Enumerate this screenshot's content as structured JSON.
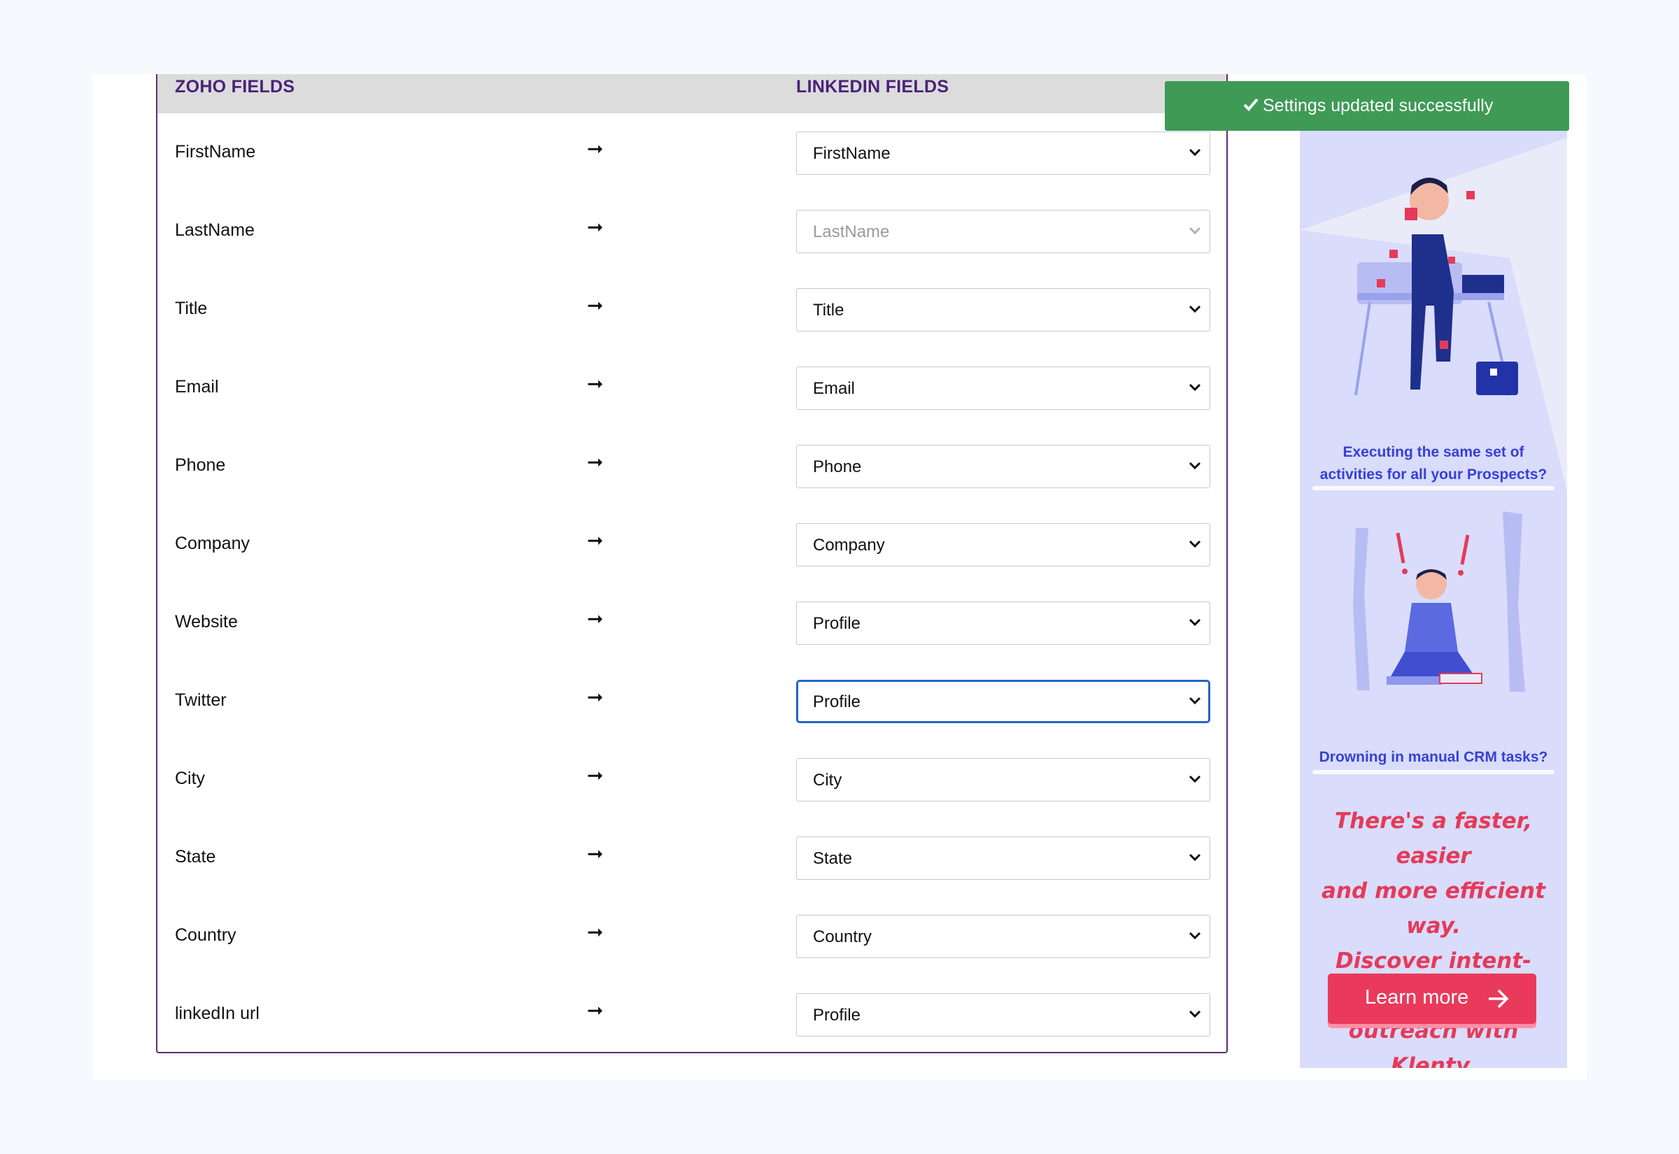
{
  "mapping": {
    "zoho_header": "ZOHO FIELDS",
    "linkedin_header": "LINKEDIN FIELDS",
    "arrow_glyph": "➞",
    "rows": [
      {
        "zoho": "FirstName",
        "linkedin": "FirstName"
      },
      {
        "zoho": "LastName",
        "linkedin": "LastName"
      },
      {
        "zoho": "Title",
        "linkedin": "Title"
      },
      {
        "zoho": "Email",
        "linkedin": "Email"
      },
      {
        "zoho": "Phone",
        "linkedin": "Phone"
      },
      {
        "zoho": "Company",
        "linkedin": "Company"
      },
      {
        "zoho": "Website",
        "linkedin": "Profile"
      },
      {
        "zoho": "Twitter",
        "linkedin": "Profile"
      },
      {
        "zoho": "City",
        "linkedin": "City"
      },
      {
        "zoho": "State",
        "linkedin": "State"
      },
      {
        "zoho": "Country",
        "linkedin": "Country"
      },
      {
        "zoho": "linkedIn url",
        "linkedin": "Profile"
      }
    ]
  },
  "toast": {
    "message": "Settings updated successfully",
    "color": "#3f9a56"
  },
  "ad": {
    "caption1": "Executing the same set of activities for all your Prospects?",
    "caption2": "Drowning in manual CRM tasks?",
    "pitch_line1": "There's a faster, easier",
    "pitch_line2": "and more efficient way.",
    "pitch_line3": "Discover intent-based",
    "pitch_line4_prefix": "outreach with ",
    "pitch_brand": "Klenty.",
    "cta_label": "Learn more",
    "accent": "#e93a5b",
    "caption_color": "#3740d6"
  }
}
